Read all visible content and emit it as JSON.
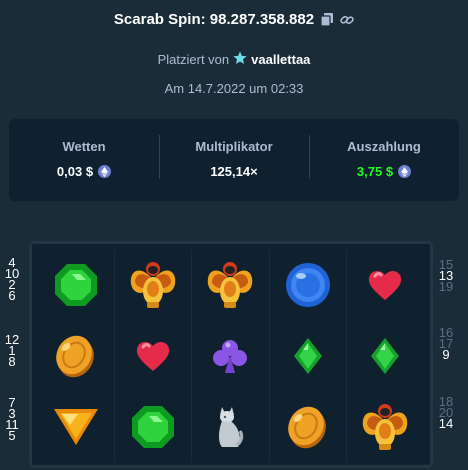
{
  "header": {
    "title": "Scarab Spin: 98.287.358.882",
    "placed_prefix": "Platziert von",
    "username": "vaallettaa",
    "date": "Am 14.7.2022 um 02:33"
  },
  "stats": {
    "bet_label": "Wetten",
    "bet_value": "0,03 $",
    "multiplier_label": "Multiplikator",
    "multiplier_value": "125,14×",
    "payout_label": "Auszahlung",
    "payout_value": "3,75 $"
  },
  "colors": {
    "background": "#1a2c38",
    "panel": "#0f212e",
    "payout_green": "#1fff20",
    "muted_text": "#b1bad3"
  },
  "reels": {
    "rows": [
      [
        "green-gem-icon",
        "scarab-icon",
        "scarab-icon",
        "blue-orb-icon",
        "heart-icon"
      ],
      [
        "gold-coin-icon",
        "heart-icon",
        "club-icon",
        "green-diamond-icon",
        "green-diamond-icon"
      ],
      [
        "triangle-gem-icon",
        "green-gem-icon",
        "cat-statue-icon",
        "gold-coin-icon",
        "scarab-icon"
      ]
    ]
  },
  "paylines": {
    "left": [
      [
        "4",
        "10",
        "2",
        "6"
      ],
      [
        "12",
        "1",
        "8"
      ],
      [
        "7",
        "3",
        "11",
        "5"
      ]
    ],
    "right": [
      [
        "15",
        "13",
        "19"
      ],
      [
        "16",
        "17",
        "9"
      ],
      [
        "18",
        "20",
        "14"
      ]
    ]
  }
}
